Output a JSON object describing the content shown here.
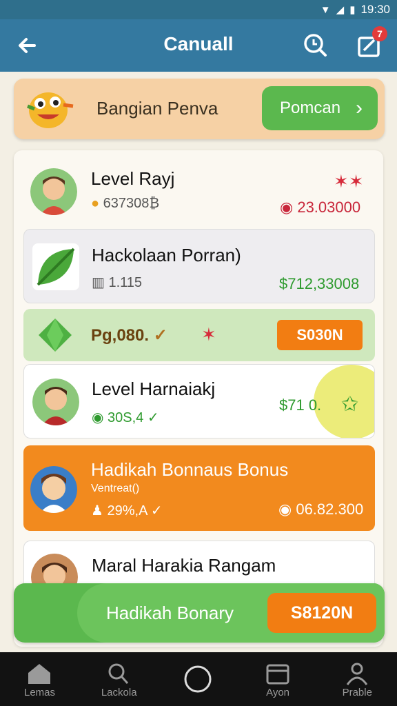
{
  "status_bar": {
    "time": "19:30"
  },
  "app_bar": {
    "title": "Canuall",
    "notification_count": "7"
  },
  "banner": {
    "text": "Bangian Penva",
    "cta_label": "Pomcan",
    "cta_arrow": "›"
  },
  "list": [
    {
      "title": "Level Rayj",
      "sub": "637308₿",
      "amount": "23.03000",
      "style": "plain"
    },
    {
      "title": "Hackolaan Porran)",
      "sub": "1.115",
      "amount": "$712,33008",
      "style": "grey"
    },
    {
      "title": "Pg,080.",
      "button": "S030N",
      "style": "green"
    },
    {
      "title": "Level Harnaiakj",
      "sub": "30S,4",
      "amount": "$71 0.",
      "style": "plain"
    },
    {
      "title": "Hadikah Bonnaus Bonus",
      "sub": "Ventreat()",
      "sub2": "29%,A",
      "amount": "06.82.300",
      "style": "orange"
    },
    {
      "title": "Maral Harakia Rangam",
      "style": "plain"
    }
  ],
  "float_bar": {
    "label": "Hadikah Bonary",
    "button": "S8120N"
  },
  "nav": [
    {
      "label": "Lemas",
      "icon": "home-icon"
    },
    {
      "label": "Lackola",
      "icon": "search-icon"
    },
    {
      "label": "",
      "icon": "circle-home-icon"
    },
    {
      "label": "Ayon",
      "icon": "wallet-icon"
    },
    {
      "label": "Prable",
      "icon": "profile-icon"
    }
  ],
  "colors": {
    "appbar": "#3479a0",
    "accent_green": "#5bb84e",
    "accent_orange": "#f27d12"
  }
}
